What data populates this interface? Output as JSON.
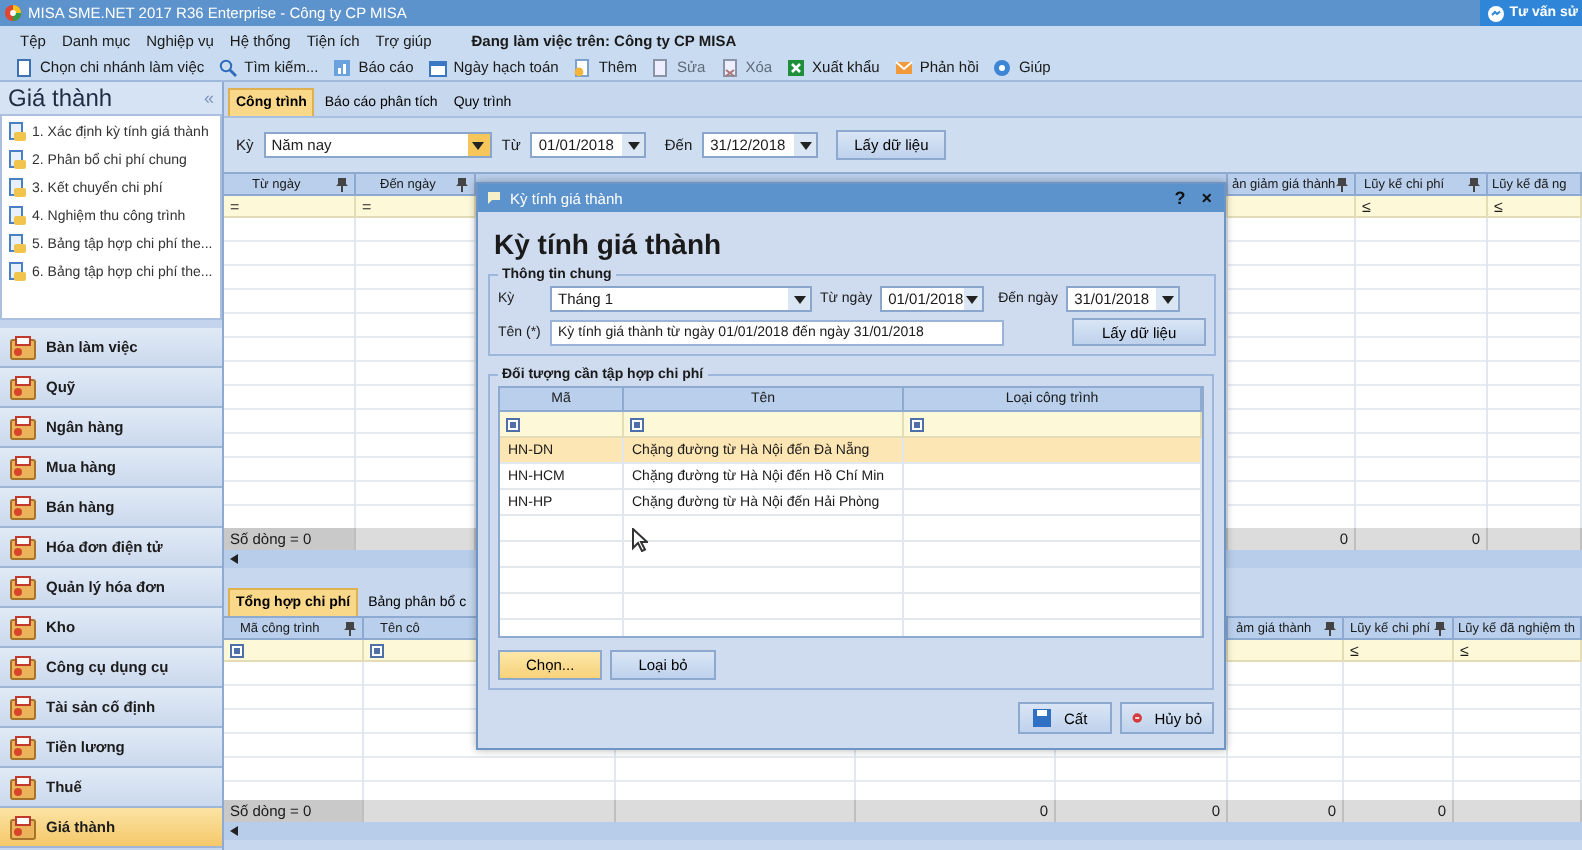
{
  "window": {
    "title": "MISA SME.NET 2017 R36 Enterprise - Công ty CP MISA",
    "chat_button": "Tư vấn sử"
  },
  "menu": {
    "items": [
      "Tệp",
      "Danh mục",
      "Nghiệp vụ",
      "Hệ thống",
      "Tiện ích",
      "Trợ giúp"
    ],
    "workspace": "Đang làm việc trên: Công ty CP MISA"
  },
  "toolbar": [
    {
      "kind": "branch",
      "label": "Chọn chi nhánh làm việc",
      "disabled": false
    },
    {
      "kind": "search",
      "label": "Tìm kiếm...",
      "disabled": false
    },
    {
      "kind": "report",
      "label": "Báo cáo",
      "disabled": false
    },
    {
      "kind": "calendar",
      "label": "Ngày hạch toán",
      "disabled": false
    },
    {
      "kind": "add",
      "label": "Thêm",
      "disabled": false
    },
    {
      "kind": "edit",
      "label": "Sửa",
      "disabled": true
    },
    {
      "kind": "delete",
      "label": "Xóa",
      "disabled": true
    },
    {
      "kind": "excel",
      "label": "Xuất khẩu",
      "disabled": false
    },
    {
      "kind": "mail",
      "label": "Phản hồi",
      "disabled": false
    },
    {
      "kind": "help",
      "label": "Giúp",
      "disabled": false
    }
  ],
  "sidebar": {
    "title": "Giá thành",
    "collapse": "«",
    "tasks": [
      "1. Xác định kỳ tính giá thành",
      "2. Phân bổ chi phí chung",
      "3. Kết chuyển chi phí",
      "4. Nghiệm thu công trình",
      "5. Bảng tập hợp chi phí the...",
      "6. Bảng tập hợp chi phí the..."
    ],
    "modules": [
      {
        "label": "Bàn làm việc",
        "selected": false
      },
      {
        "label": "Quỹ",
        "selected": false
      },
      {
        "label": "Ngân hàng",
        "selected": false
      },
      {
        "label": "Mua hàng",
        "selected": false
      },
      {
        "label": "Bán hàng",
        "selected": false
      },
      {
        "label": "Hóa đơn điện tử",
        "selected": false
      },
      {
        "label": "Quản lý hóa đơn",
        "selected": false
      },
      {
        "label": "Kho",
        "selected": false
      },
      {
        "label": "Công cụ dụng cụ",
        "selected": false
      },
      {
        "label": "Tài sản cố định",
        "selected": false
      },
      {
        "label": "Tiền lương",
        "selected": false
      },
      {
        "label": "Thuế",
        "selected": false
      },
      {
        "label": "Giá thành",
        "selected": true
      }
    ]
  },
  "main": {
    "tabs": [
      {
        "label": "Công trình",
        "selected": true
      },
      {
        "label": "Báo cáo phân tích",
        "selected": false
      },
      {
        "label": "Quy trình",
        "selected": false
      }
    ],
    "filter": {
      "period_label": "Kỳ",
      "period": "Năm nay",
      "from_label": "Từ",
      "from": "01/01/2018",
      "to_label": "Đến",
      "to": "31/12/2018",
      "fetch_button": "Lấy dữ liệu"
    },
    "top_grid": {
      "columns": [
        {
          "label": "Từ ngày",
          "pinned": true,
          "filter": "="
        },
        {
          "label": "Đến ngày",
          "pinned": true,
          "filter": "="
        },
        {
          "label": "ản giảm giá thành",
          "pinned": true,
          "total": "0"
        },
        {
          "label": "Lũy kế chi phí",
          "pinned": true,
          "filter": "≤",
          "total": "0"
        },
        {
          "label": "Lũy kế đã ng",
          "filter": "≤"
        }
      ],
      "row_count": "Số dòng = 0"
    },
    "bottom_tabs": [
      {
        "label": "Tổng hợp chi phí",
        "selected": true
      },
      {
        "label": "Bảng phân bổ c",
        "selected": false
      }
    ],
    "bottom_grid": {
      "columns": [
        {
          "label": "Mã công trình",
          "pinned": true,
          "filter_icon": true
        },
        {
          "label": "Tên cô",
          "filter_icon": true
        },
        {},
        {
          "total": "0"
        },
        {
          "total": "0"
        },
        {
          "label": "ảm giá thành",
          "pinned": true,
          "total": "0"
        },
        {
          "label": "Lũy kế chi phí",
          "pinned": true,
          "filter": "≤",
          "total": "0"
        },
        {
          "label": "Lũy kế đã nghiệm th",
          "filter": "≤"
        }
      ],
      "row_count": "Số dòng = 0"
    }
  },
  "dialog": {
    "title": "Kỳ tính giá thành",
    "help": "?",
    "close": "×",
    "heading": "Kỳ tính giá thành",
    "general": {
      "title": "Thông tin chung",
      "period_label": "Kỳ",
      "period": "Tháng 1",
      "from_label": "Từ ngày",
      "from": "01/01/2018",
      "to_label": "Đến ngày",
      "to": "31/01/2018",
      "name_label": "Tên (*)",
      "name": "Kỳ tính giá thành từ ngày 01/01/2018 đến ngày 31/01/2018",
      "fetch_button": "Lấy dữ liệu"
    },
    "objects": {
      "title": "Đối tượng cần tập hợp chi phí",
      "columns": [
        "Mã",
        "Tên",
        "Loại công trình"
      ],
      "rows": [
        {
          "code": "HN-DN",
          "name": "Chặng đường từ Hà Nội đến Đà Nẵng",
          "selected": true
        },
        {
          "code": "HN-HCM",
          "name": "Chặng đường từ Hà Nội đến Hồ Chí Min",
          "selected": false
        },
        {
          "code": "HN-HP",
          "name": "Chặng đường từ Hà Nội đến Hải Phòng",
          "selected": false
        }
      ],
      "buttons": [
        {
          "label": "Chọn...",
          "focused": true
        },
        {
          "label": "Loại bỏ",
          "focused": false
        }
      ]
    },
    "save_button": "Cất",
    "cancel_button": "Hủy bỏ"
  }
}
